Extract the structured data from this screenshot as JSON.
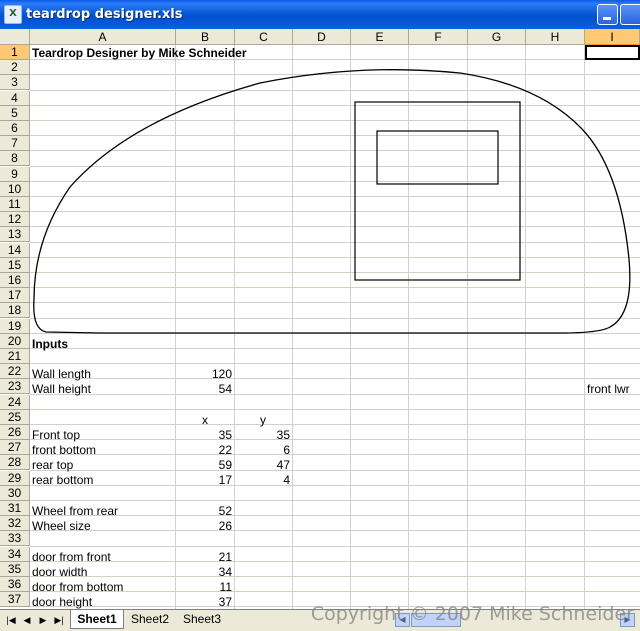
{
  "window": {
    "title": "teardrop designer.xls",
    "icon": "excel-icon"
  },
  "columns": [
    "A",
    "B",
    "C",
    "D",
    "E",
    "F",
    "G",
    "H",
    "I"
  ],
  "selected_column": "I",
  "active_cell": "I1",
  "rows": [
    "1",
    "2",
    "3",
    "4",
    "5",
    "6",
    "7",
    "8",
    "9",
    "10",
    "11",
    "12",
    "13",
    "14",
    "15",
    "16",
    "17",
    "18",
    "19",
    "20",
    "21",
    "22",
    "23",
    "24",
    "25",
    "26",
    "27",
    "28",
    "29",
    "30",
    "31",
    "32",
    "33",
    "34",
    "35",
    "36",
    "37"
  ],
  "cells": {
    "title": "Teardrop Designer by Mike Schneider",
    "inputs_heading": "Inputs",
    "wall_length_label": "Wall length",
    "wall_length": "120",
    "wall_height_label": "Wall height",
    "wall_height": "54",
    "front_lwr": "front lwr",
    "x_header": "x",
    "y_header": "y",
    "front_top_label": "Front top",
    "front_top_x": "35",
    "front_top_y": "35",
    "front_bottom_label": "front bottom",
    "front_bottom_x": "22",
    "front_bottom_y": "6",
    "rear_top_label": "rear top",
    "rear_top_x": "59",
    "rear_top_y": "47",
    "rear_bottom_label": "rear bottom",
    "rear_bottom_x": "17",
    "rear_bottom_y": "4",
    "wheel_from_rear_label": "Wheel from rear",
    "wheel_from_rear": "52",
    "wheel_size_label": "Wheel size",
    "wheel_size": "26",
    "door_from_front_label": "door from front",
    "door_from_front": "21",
    "door_width_label": "door width",
    "door_width": "34",
    "door_from_bottom_label": "door from bottom",
    "door_from_bottom": "11",
    "door_height_label": "door height",
    "door_height": "37"
  },
  "sheet_tabs": [
    "Sheet1",
    "Sheet2",
    "Sheet3"
  ],
  "active_tab": "Sheet1",
  "watermark": "Copyright © 2007 Mike Schneider"
}
